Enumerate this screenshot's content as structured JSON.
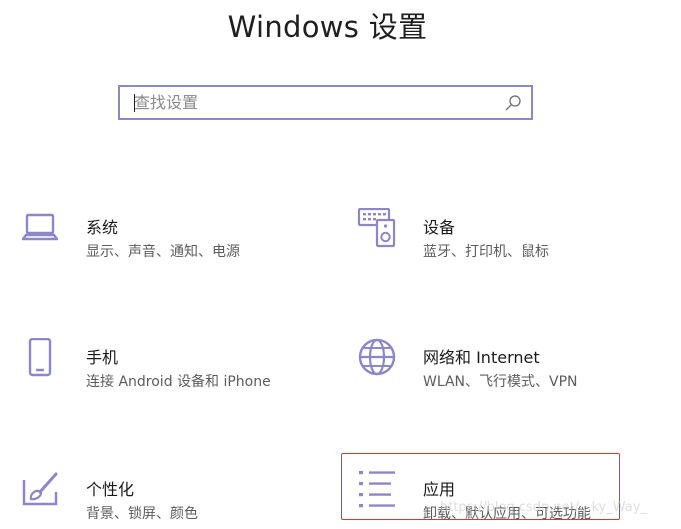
{
  "header": {
    "title": "Windows 设置"
  },
  "search": {
    "placeholder": "查找设置",
    "icon": "search-icon"
  },
  "tiles": [
    {
      "id": "system",
      "icon": "laptop-icon",
      "title": "系统",
      "desc": "显示、声音、通知、电源"
    },
    {
      "id": "devices",
      "icon": "keyboard-speaker-icon",
      "title": "设备",
      "desc": "蓝牙、打印机、鼠标"
    },
    {
      "id": "phone",
      "icon": "phone-icon",
      "title": "手机",
      "desc": "连接 Android 设备和 iPhone"
    },
    {
      "id": "network",
      "icon": "globe-icon",
      "title": "网络和 Internet",
      "desc": "WLAN、飞行模式、VPN"
    },
    {
      "id": "personalization",
      "icon": "paint-brush-icon",
      "title": "个性化",
      "desc": "背景、锁屏、颜色"
    },
    {
      "id": "apps",
      "icon": "app-list-icon",
      "title": "应用",
      "desc": "卸载、默认应用、可选功能"
    }
  ],
  "colors": {
    "accent": "#8d86c9",
    "selected_border": "#d23a3a"
  },
  "watermark": "https://blog.csdn.net/...ky_Way_"
}
